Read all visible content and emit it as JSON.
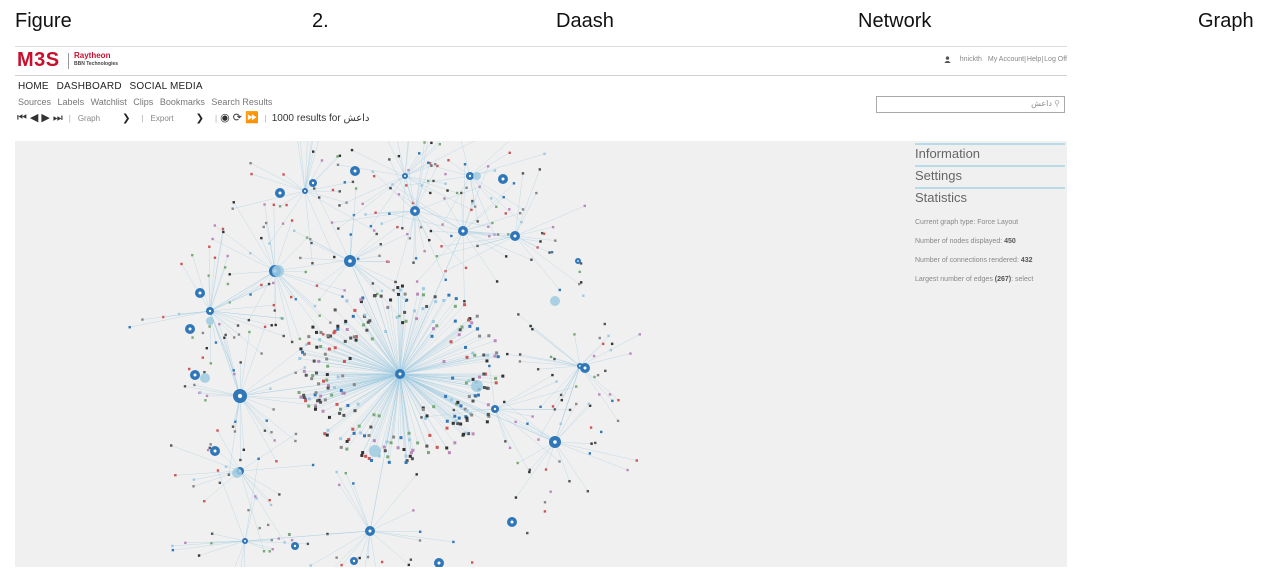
{
  "caption": {
    "word1": "Figure",
    "word2": "2.",
    "word3": "Daash",
    "word4": "Network",
    "word5": "Graph"
  },
  "header": {
    "logo": "M3S",
    "brand_top": "Raytheon",
    "brand_bottom": "BBN Technologies",
    "user": "hnickth",
    "my_account": "My Account",
    "help": "Help",
    "log_off": "Log Off"
  },
  "nav": {
    "items": [
      "HOME",
      "DASHBOARD",
      "SOCIAL MEDIA"
    ]
  },
  "subnav": {
    "items": [
      "Sources",
      "Labels",
      "Watchlist",
      "Clips",
      "Bookmarks",
      "Search Results"
    ]
  },
  "search": {
    "value": "داعش"
  },
  "toolbar": {
    "view_select": "Graph",
    "export_select": "Export",
    "results_text": "1000 results for داعش"
  },
  "side_panel": {
    "sections": [
      "Information",
      "Settings",
      "Statistics"
    ],
    "stats": {
      "graph_type_label": "Current graph type:",
      "graph_type_value": "Force Layout",
      "nodes_label": "Number of nodes displayed:",
      "nodes_value": "450",
      "connections_label": "Number of connections rendered:",
      "connections_value": "432",
      "largest_label": "Largest number of edges",
      "largest_value": "(267)",
      "largest_suffix": ": select"
    }
  },
  "colors": {
    "accent_red": "#c8102e",
    "node_blue": "#2f77b8",
    "node_light_blue": "#9ecae1",
    "edge": "#9ecae1",
    "canvas_bg": "#f0f0f0"
  },
  "icons": {
    "user": "user-icon",
    "first": "first-page-icon",
    "prev": "prev-icon",
    "next": "next-icon",
    "last": "last-page-icon",
    "dropdown": "chevron-down-icon",
    "eye": "eye-icon",
    "refresh": "refresh-icon",
    "fast_forward": "fast-forward-icon"
  }
}
